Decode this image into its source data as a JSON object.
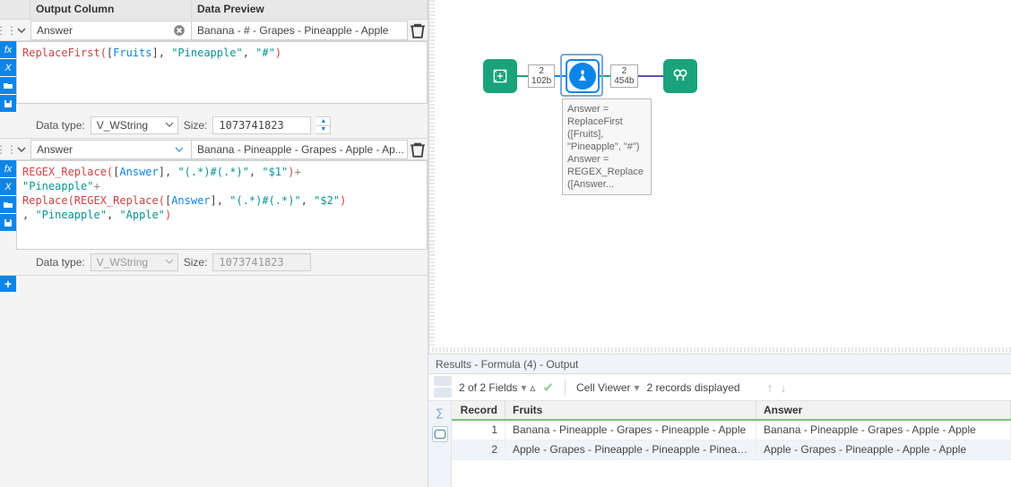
{
  "headers": {
    "output_column": "Output Column",
    "data_preview": "Data Preview"
  },
  "blocks": [
    {
      "field": "Answer",
      "has_clear": true,
      "preview": "Banana - # - Grapes - Pineapple - Apple",
      "code_html": "<span class='c-fn'>ReplaceFirst(</span>[<span class='c-col'>Fruits</span>], <span class='c-str'>\"Pineapple\"</span>, <span class='c-str'>\"#\"</span><span class='c-fn'>)</span>",
      "data_type": "V_WString",
      "size": "1073741823",
      "spinner": true
    },
    {
      "field": "Answer",
      "has_dropdown": true,
      "preview": "Banana - Pineapple - Grapes - Apple - Ap...",
      "code_html": "<span class='c-fn'>REGEX_Replace(</span>[<span class='c-col'>Answer</span>], <span class='c-str'>\"(.*)#(.*)\"</span>, <span class='c-str'>\"$1\"</span><span class='c-fn'>)</span><span class='c-op'>+</span>\n<span class='c-str'>\"Pineapple\"</span><span class='c-op'>+</span>\n<span class='c-fn'>Replace(REGEX_Replace(</span>[<span class='c-col'>Answer</span>], <span class='c-str'>\"(.*)#(.*)\"</span>, <span class='c-str'>\"$2\"</span><span class='c-fn'>)</span>\n, <span class='c-str'>\"Pineapple\"</span>, <span class='c-str'>\"Apple\"</span><span class='c-fn'>)</span>",
      "data_type": "V_WString",
      "size": "1073741823",
      "dtype_disabled": true
    }
  ],
  "labels": {
    "data_type": "Data type:",
    "size": "Size:"
  },
  "workflow": {
    "pin1": {
      "top": "2",
      "bot": "102b"
    },
    "pin2": {
      "top": "2",
      "bot": "454b"
    },
    "annotation": "Answer =\nReplaceFirst\n([Fruits],\n\"Pineapple\", \"#\")\nAnswer =\nREGEX_Replace\n([Answer..."
  },
  "results": {
    "title": "Results - Formula (4) - Output",
    "fields_label": "2 of 2 Fields",
    "cell_viewer": "Cell Viewer",
    "records_label": "2 records displayed",
    "columns": {
      "record": "Record",
      "fruits": "Fruits",
      "answer": "Answer"
    },
    "rows": [
      {
        "n": "1",
        "fruits": "Banana - Pineapple - Grapes - Pineapple - Apple",
        "answer": "Banana - Pineapple - Grapes - Apple - Apple"
      },
      {
        "n": "2",
        "fruits": "Apple - Grapes - Pineapple - Pineapple - Pineapp...",
        "answer": "Apple - Grapes - Pineapple - Apple - Apple"
      }
    ]
  }
}
